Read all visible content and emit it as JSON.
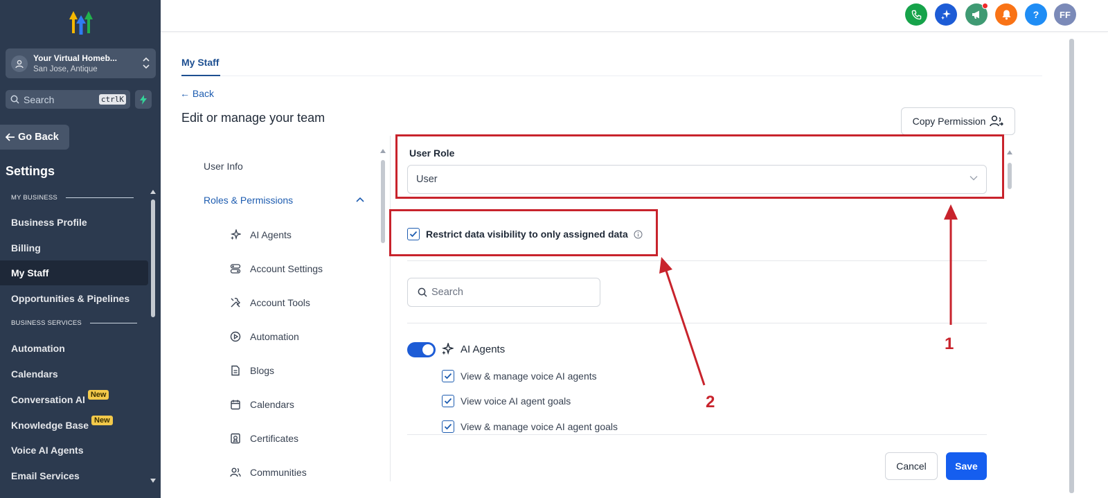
{
  "sidebar": {
    "account": {
      "name": "Your Virtual Homeb...",
      "location": "San Jose, Antique"
    },
    "search": {
      "placeholder": "Search",
      "shortcut": "ctrlK"
    },
    "go_back": "Go Back",
    "settings_title": "Settings",
    "sections": [
      {
        "label": "MY BUSINESS"
      },
      {
        "label": "BUSINESS SERVICES"
      }
    ],
    "items": [
      {
        "label": "Business Profile"
      },
      {
        "label": "Billing"
      },
      {
        "label": "My Staff",
        "active": true
      },
      {
        "label": "Opportunities & Pipelines"
      },
      {
        "label": "Automation"
      },
      {
        "label": "Calendars"
      },
      {
        "label": "Conversation AI",
        "badge": "New"
      },
      {
        "label": "Knowledge Base",
        "badge": "New"
      },
      {
        "label": "Voice AI Agents"
      },
      {
        "label": "Email Services"
      }
    ]
  },
  "topbar": {
    "icons": [
      {
        "name": "phone-icon",
        "color": "#16a34a"
      },
      {
        "name": "sparkle-icon",
        "color": "#1d5cd6"
      },
      {
        "name": "megaphone-icon",
        "color": "#3f9a73"
      },
      {
        "name": "bell-icon",
        "color": "#f97316"
      },
      {
        "name": "help-icon",
        "label": "?",
        "color": "#1f8df5"
      },
      {
        "name": "user-avatar",
        "label": "FF",
        "color": "#7b8ab8"
      }
    ]
  },
  "main": {
    "tab": "My Staff",
    "back": "Back",
    "title": "Edit or manage your team",
    "copy_permission": "Copy Permission",
    "subnav": [
      {
        "label": "User Info"
      },
      {
        "label": "Roles & Permissions",
        "active": true,
        "expanded": true
      },
      {
        "label": "AI Agents",
        "icon": "sparkle-icon"
      },
      {
        "label": "Account Settings",
        "icon": "settings-toggle-icon"
      },
      {
        "label": "Account Tools",
        "icon": "tools-icon"
      },
      {
        "label": "Automation",
        "icon": "play-circle-icon"
      },
      {
        "label": "Blogs",
        "icon": "document-icon"
      },
      {
        "label": "Calendars",
        "icon": "calendar-icon"
      },
      {
        "label": "Certificates",
        "icon": "certificate-icon"
      },
      {
        "label": "Communities",
        "icon": "users-icon"
      }
    ],
    "user_role": {
      "label": "User Role",
      "value": "User"
    },
    "restrict": {
      "label": "Restrict data visibility to only assigned data",
      "checked": true
    },
    "perm_search": {
      "placeholder": "Search"
    },
    "group": {
      "title": "AI Agents",
      "enabled": true,
      "permissions": [
        {
          "label": "View & manage voice AI agents",
          "checked": true
        },
        {
          "label": "View voice AI agent goals",
          "checked": true
        },
        {
          "label": "View & manage voice AI agent goals",
          "checked": true
        }
      ]
    },
    "cancel": "Cancel",
    "save": "Save"
  },
  "annotations": {
    "color": "#c8232c",
    "labels": [
      {
        "number": "1"
      },
      {
        "number": "2"
      }
    ]
  }
}
